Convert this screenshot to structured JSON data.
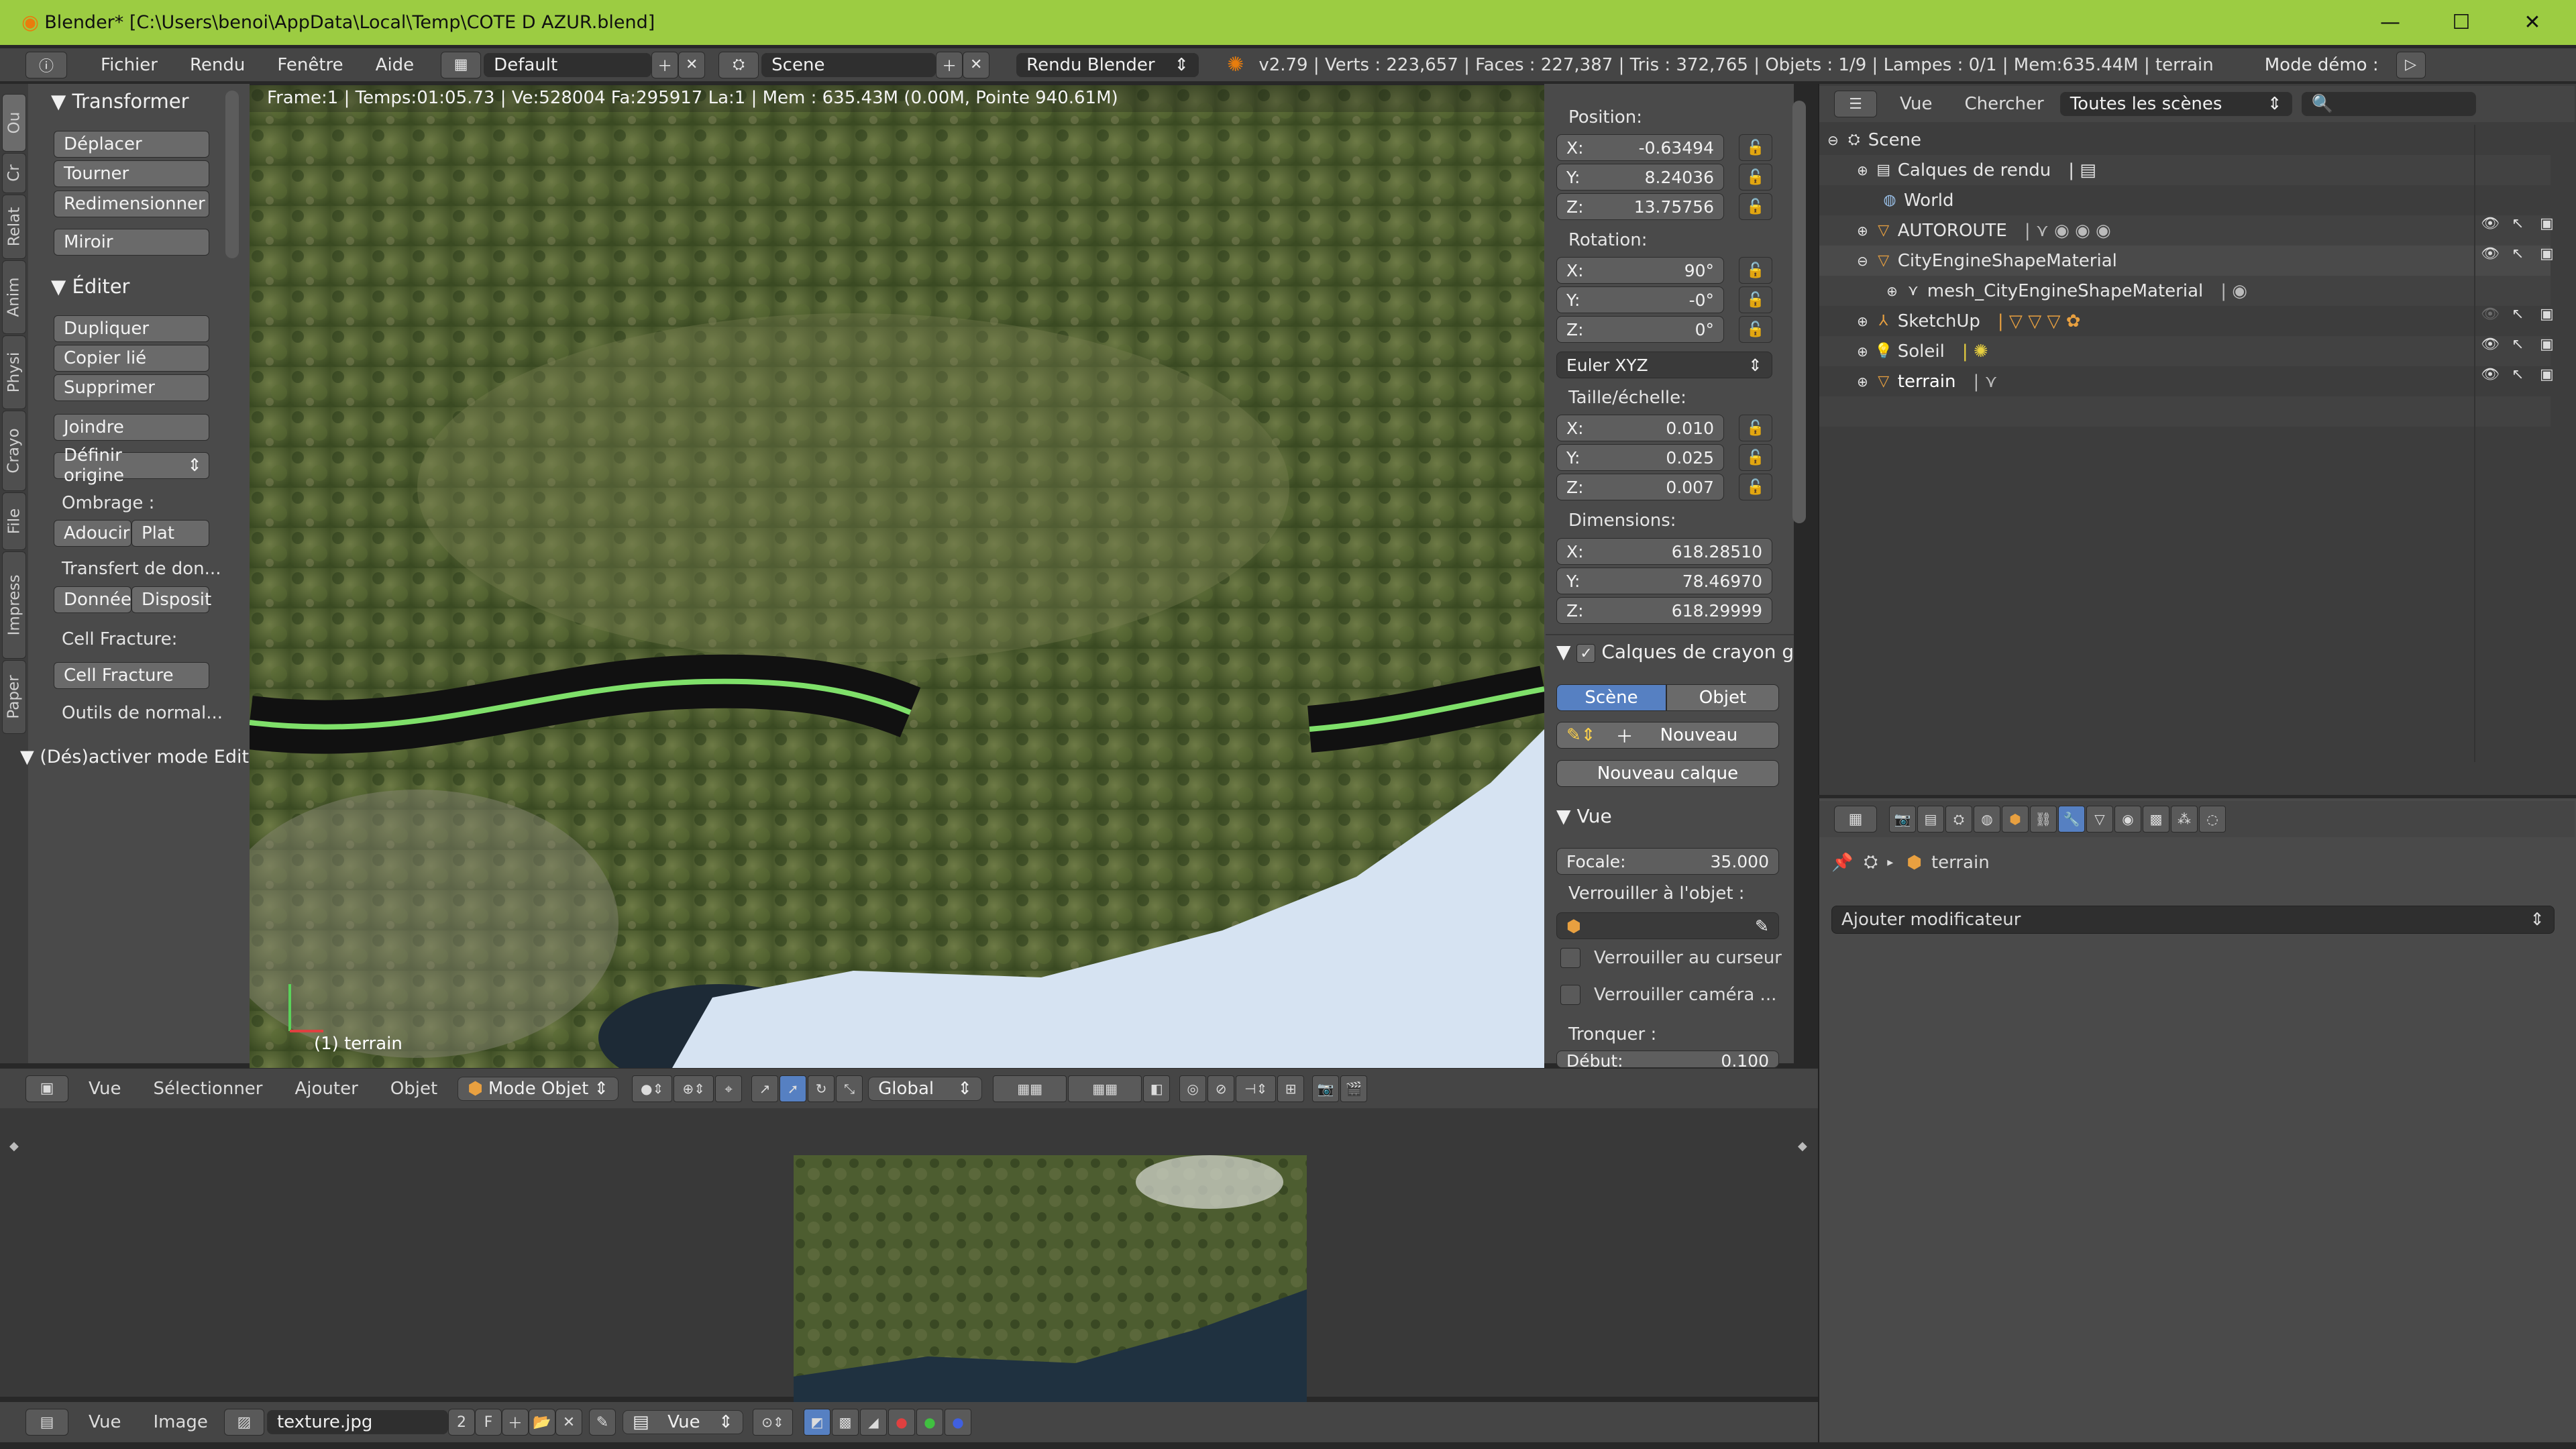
{
  "window": {
    "title": "Blender* [C:\\Users\\benoi\\AppData\\Local\\Temp\\COTE D AZUR.blend]",
    "controls": {
      "minimize": "—",
      "maximize": "☐",
      "close": "✕"
    }
  },
  "menubar": {
    "menus": [
      "Fichier",
      "Rendu",
      "Fenêtre",
      "Aide"
    ],
    "layout": "Default",
    "scene": "Scene",
    "engine": "Rendu Blender",
    "stats": "v2.79 | Verts : 223,657 | Faces : 227,387 | Tris : 372,765 | Objets : 1/9 | Lampes : 0/1 | Mem:635.44M | terrain",
    "demo": "Mode démo :"
  },
  "toolshelf": {
    "tabs": [
      "Ou",
      "Cr",
      "Relat",
      "Anim",
      "Physi",
      "Crayo",
      "File",
      "Impress",
      "Paper"
    ],
    "transform_title": "Transformer",
    "transform_buttons": [
      "Déplacer",
      "Tourner",
      "Redimensionner"
    ],
    "mirror": "Miroir",
    "edit_title": "Éditer",
    "edit_buttons": [
      "Dupliquer",
      "Copier lié",
      "Supprimer"
    ],
    "join": "Joindre",
    "set_origin": "Définir origine",
    "shading_label": "Ombrage :",
    "smooth": "Adoucir",
    "flat": "Plat",
    "data_transfer": "Transfert de don...",
    "data": "Donnée",
    "layout": "Disposit",
    "cell_fracture_label": "Cell Fracture:",
    "cell_fracture": "Cell Fracture",
    "normal_tools": "Outils de normal...",
    "toggle_edit": "(Dés)activer mode Edit"
  },
  "viewport": {
    "info": "Frame:1 | Temps:01:05.73 | Ve:528004 Fa:295917 La:1 | Mem : 635.43M (0.00M, Pointe 940.61M)",
    "object_label": "(1) terrain"
  },
  "npanel": {
    "position_label": "Position:",
    "position": {
      "x": "X:",
      "xv": "-0.63494",
      "y": "Y:",
      "yv": "8.24036",
      "z": "Z:",
      "zv": "13.75756"
    },
    "rotation_label": "Rotation:",
    "rotation": {
      "x": "X:",
      "xv": "90°",
      "y": "Y:",
      "yv": "-0°",
      "z": "Z:",
      "zv": "0°"
    },
    "rotation_mode": "Euler XYZ",
    "scale_label": "Taille/échelle:",
    "scale": {
      "x": "X:",
      "xv": "0.010",
      "y": "Y:",
      "yv": "0.025",
      "z": "Z:",
      "zv": "0.007"
    },
    "dimensions_label": "Dimensions:",
    "dimensions": {
      "x": "X:",
      "xv": "618.28510",
      "y": "Y:",
      "yv": "78.46970",
      "z": "Z:",
      "zv": "618.29999"
    },
    "gp_layers": "Calques de crayon g",
    "scene_btn": "Scène",
    "object_btn": "Objet",
    "new_btn": "Nouveau",
    "new_layer_btn": "Nouveau calque",
    "view_title": "Vue",
    "focal_label": "Focale:",
    "focal_value": "35.000",
    "lock_object_label": "Verrouiller à l'objet :",
    "lock_cursor": "Verrouiller au curseur",
    "lock_camera": "Verrouiller caméra ...",
    "clip_label": "Tronquer :",
    "clip_start_label": "Début:",
    "clip_start_value": "0.100"
  },
  "vptoolbar": {
    "menus": [
      "Vue",
      "Sélectionner",
      "Ajouter",
      "Objet"
    ],
    "mode": "Mode Objet",
    "orientation": "Global"
  },
  "imgtoolbar": {
    "menus": [
      "Vue",
      "Image"
    ],
    "image_name": "texture.jpg",
    "users": "2",
    "fake": "F",
    "view_mode": "Vue"
  },
  "outliner": {
    "menus": [
      "Vue",
      "Chercher"
    ],
    "filter": "Toutes les scènes",
    "rows": [
      {
        "label": "Scene"
      },
      {
        "label": "Calques de rendu"
      },
      {
        "label": "World"
      },
      {
        "label": "AUTOROUTE"
      },
      {
        "label": "CityEngineShapeMaterial"
      },
      {
        "label": "mesh_CityEngineShapeMaterial"
      },
      {
        "label": "SketchUp"
      },
      {
        "label": "Soleil"
      },
      {
        "label": "terrain"
      }
    ]
  },
  "properties": {
    "breadcrumb": "terrain",
    "add_modifier": "Ajouter modificateur"
  },
  "colors": {
    "title_bar": "#9ccc42",
    "accent_blue": "#5680c2",
    "road_green": "#7fe06a"
  }
}
